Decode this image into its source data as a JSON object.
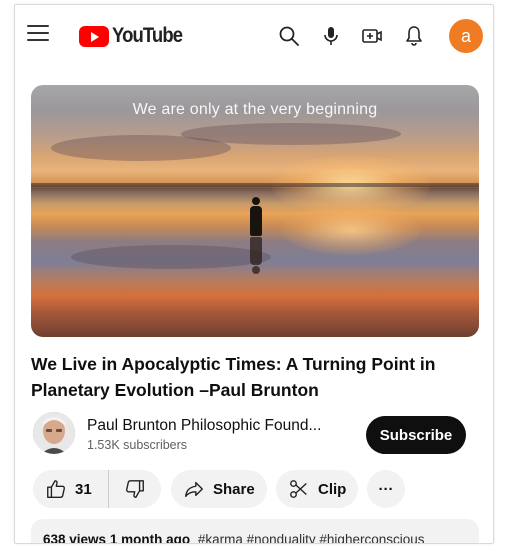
{
  "header": {
    "logo_text": "YouTube",
    "avatar_letter": "a",
    "avatar_color": "#ef7b22",
    "icons": [
      "menu-icon",
      "search-icon",
      "microphone-icon",
      "create-icon",
      "bell-icon"
    ]
  },
  "video": {
    "thumbnail_text": "We are only at the very beginning",
    "title": "We Live in Apocalyptic Times: A Turning Point in Planetary Evolution –Paul Brunton",
    "views": "638 views",
    "age": "1 month ago",
    "hashtags": "#karma #nonduality #higherconscious"
  },
  "channel": {
    "name": "Paul Brunton Philosophic Found...",
    "subscribers": "1.53K subscribers",
    "subscribe_label": "Subscribe"
  },
  "actions": {
    "like_count": "31",
    "share_label": "Share",
    "clip_label": "Clip",
    "more_label": "···"
  },
  "colors": {
    "brand_red": "#ff0000",
    "subscribe_bg": "#0f0f0f",
    "pill_bg": "#f2f2f2"
  }
}
